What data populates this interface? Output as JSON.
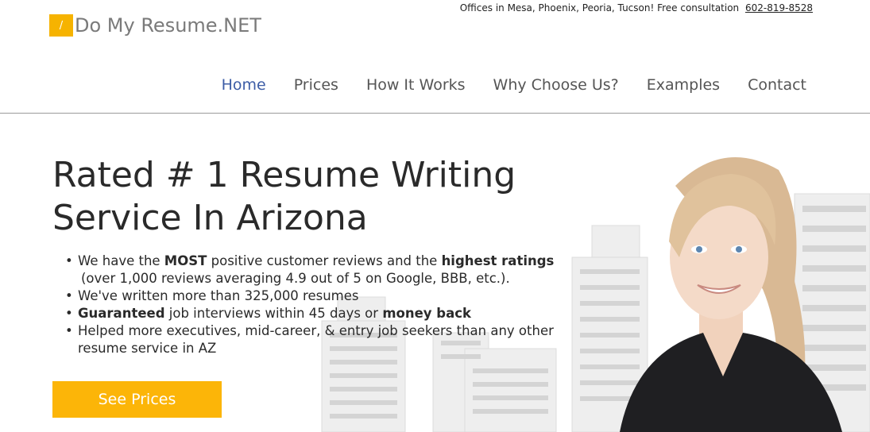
{
  "brand": {
    "logo_glyph": "/",
    "name": "Do My Resume.NET",
    "accent_color": "#f6b300"
  },
  "topbar": {
    "text": "Offices in Mesa, Phoenix, Peoria, Tucson! Free consultation",
    "phone": "602-819-8528"
  },
  "nav": {
    "items": [
      {
        "label": "Home",
        "active": true
      },
      {
        "label": "Prices"
      },
      {
        "label": "How It Works"
      },
      {
        "label": "Why Choose Us?"
      },
      {
        "label": "Examples"
      },
      {
        "label": "Contact"
      }
    ]
  },
  "hero": {
    "headline_line1": "Rated # 1 Resume Writing",
    "headline_line2": "Service In Arizona",
    "bullets": {
      "b1_pre": "We have the ",
      "b1_bold1": "MOST",
      "b1_mid": " positive customer reviews and the ",
      "b1_bold2": "highest ratings",
      "b1_sub": "(over 1,000 reviews averaging 4.9 out of 5 on Google, BBB, etc.).",
      "b2": "We've written more than 325,000 resumes",
      "b3_bold1": "Guaranteed",
      "b3_mid": " job interviews within 45 days or ",
      "b3_bold2": "money back",
      "b4": "Helped more executives, mid-career, & entry job seekers than any other resume service in AZ"
    },
    "cta_label": "See Prices"
  }
}
